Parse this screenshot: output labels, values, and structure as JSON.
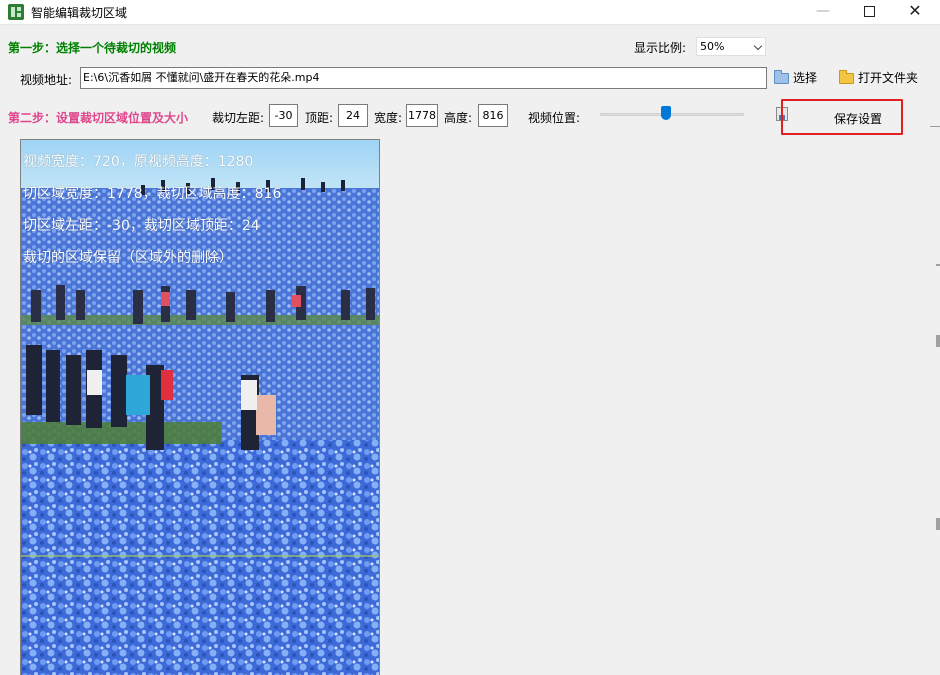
{
  "window": {
    "title": "智能编辑裁切区域",
    "minimize": "—",
    "close": "✕"
  },
  "step1": {
    "label": "第一步：选择一个待裁切的视频",
    "ratio_label": "显示比例:",
    "ratio_value": "50%",
    "path_label": "视频地址:",
    "path_value": "E:\\6\\沉香如屑 不懂就问\\盛开在春天的花朵.mp4",
    "select_button": "选择",
    "open_folder_button": "打开文件夹"
  },
  "step2": {
    "label": "第二步：设置裁切区域位置及大小",
    "left_label": "裁切左距:",
    "left_value": "-30",
    "top_label": "顶距:",
    "top_value": "24",
    "width_label": "宽度:",
    "width_value": "1778",
    "height_label": "高度:",
    "height_value": "816",
    "position_label": "视频位置:",
    "slider_fraction": 0.46,
    "save_button": "保存设置"
  },
  "preview": {
    "lines": [
      "视频宽度：720，原视频高度：1280",
      "切区域宽度：1778，裁切区域高度：816",
      "切区域左距：-30，裁切区域顶距：24",
      "裁切的区域保留（区域外的删除）"
    ]
  },
  "colors": {
    "step1": "#008000",
    "step2": "#e0468c",
    "highlight": "#e02020",
    "slider": "#0078d7"
  }
}
